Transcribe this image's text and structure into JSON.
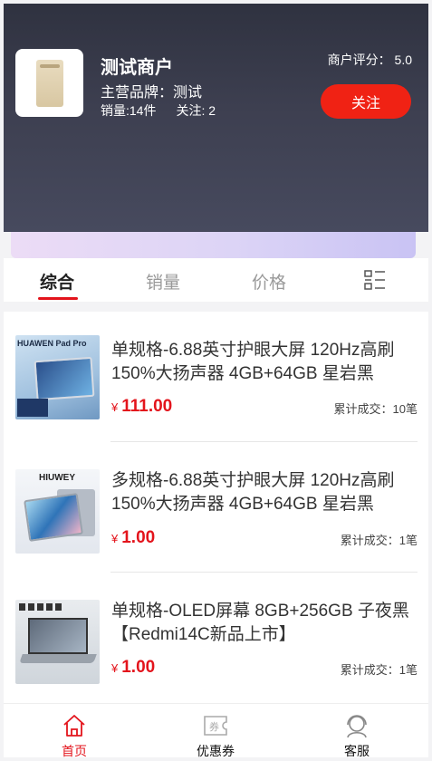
{
  "store": {
    "name": "测试商户",
    "brand": "主营品牌：测试",
    "sales": "销量:14件",
    "followers": "关注: 2",
    "rating": "商户评分： 5.0",
    "follow_label": "关注"
  },
  "sort_tabs": [
    {
      "label": "综合",
      "active": true
    },
    {
      "label": "销量",
      "active": false
    },
    {
      "label": "价格",
      "active": false
    }
  ],
  "products": [
    {
      "thumb_text": "HUAWEN Pad Pro",
      "title": "单规格-6.88英寸护眼大屏 120Hz高刷 150%大扬声器 4GB+64GB 星岩黑",
      "currency": "¥",
      "price": "111.00",
      "sold": "累计成交：10笔"
    },
    {
      "thumb_text": "HIUWEY",
      "title": "多规格-6.88英寸护眼大屏 120Hz高刷 150%大扬声器 4GB+64GB 星岩黑",
      "currency": "¥",
      "price": "1.00",
      "sold": "累计成交：1笔"
    },
    {
      "thumb_text": "",
      "title": "单规格-OLED屏幕 8GB+256GB 子夜黑【Redmi14C新品上市】",
      "currency": "¥",
      "price": "1.00",
      "sold": "累计成交：1笔"
    }
  ],
  "nav": [
    {
      "label": "首页",
      "icon": "home-icon",
      "active": true
    },
    {
      "label": "优惠券",
      "icon": "coupon-icon",
      "active": false
    },
    {
      "label": "客服",
      "icon": "customer-service-icon",
      "active": false
    }
  ],
  "colors": {
    "accent": "#e3141c",
    "follow_button": "#f02214"
  }
}
